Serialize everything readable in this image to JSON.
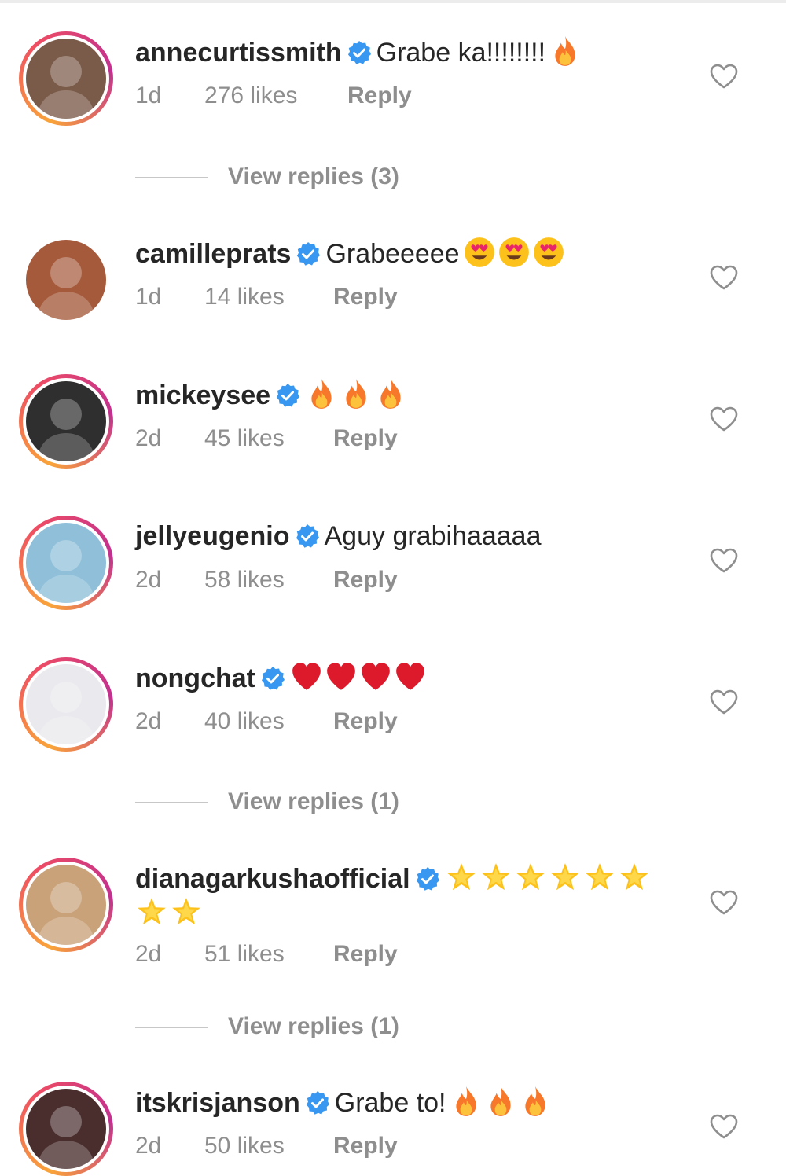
{
  "comments": [
    {
      "username": "annecurtissmith",
      "text": "Grabe ka!!!!!!!!",
      "emojis": [
        "fire"
      ],
      "time": "1d",
      "likes": "276 likes",
      "reply": "Reply",
      "ring": true,
      "avatar_color": "#7a5a48"
    },
    {
      "username": "camilleprats",
      "text": "Grabeeeee",
      "emojis": [
        "heart-eyes",
        "heart-eyes",
        "heart-eyes"
      ],
      "time": "1d",
      "likes": "14 likes",
      "reply": "Reply",
      "ring": false,
      "avatar_color": "#a55a3c"
    },
    {
      "username": "mickeysee",
      "text": "",
      "emojis": [
        "fire",
        "fire",
        "fire"
      ],
      "time": "2d",
      "likes": "45 likes",
      "reply": "Reply",
      "ring": true,
      "avatar_color": "#2f2f2f"
    },
    {
      "username": "jellyeugenio",
      "text": "Aguy grabihaaaaa",
      "emojis": [],
      "time": "2d",
      "likes": "58 likes",
      "reply": "Reply",
      "ring": true,
      "avatar_color": "#8fbfd9"
    },
    {
      "username": "nongchat",
      "text": "",
      "emojis": [
        "red-heart",
        "red-heart",
        "red-heart",
        "red-heart"
      ],
      "time": "2d",
      "likes": "40 likes",
      "reply": "Reply",
      "ring": true,
      "avatar_color": "#e9e9ee"
    },
    {
      "username": "dianagarkushaofficial",
      "text": "",
      "emojis": [
        "star",
        "star",
        "star",
        "star",
        "star",
        "star"
      ],
      "emojis_line2": [
        "star",
        "star"
      ],
      "time": "2d",
      "likes": "51 likes",
      "reply": "Reply",
      "ring": true,
      "avatar_color": "#c9a27a"
    },
    {
      "username": "itskrisjanson",
      "text": "Grabe to!",
      "emojis": [
        "fire",
        "fire",
        "fire"
      ],
      "time": "2d",
      "likes": "50 likes",
      "reply": "Reply",
      "ring": true,
      "avatar_color": "#4a2e2e"
    }
  ],
  "view_replies": [
    {
      "after": "annecurtissmith",
      "label": "View replies (3)"
    },
    {
      "after": "nongchat",
      "label": "View replies (1)"
    },
    {
      "after": "dianagarkushaofficial",
      "label": "View replies (1)"
    }
  ],
  "colors": {
    "verified": "#3897f0",
    "meta_text": "#8e8e8e",
    "username": "#262626",
    "ring_gradient": [
      "#f9a43a",
      "#ee4d63",
      "#c2308f"
    ]
  },
  "icons": {
    "verified": "verified-badge-icon",
    "like": "heart-outline-icon"
  }
}
